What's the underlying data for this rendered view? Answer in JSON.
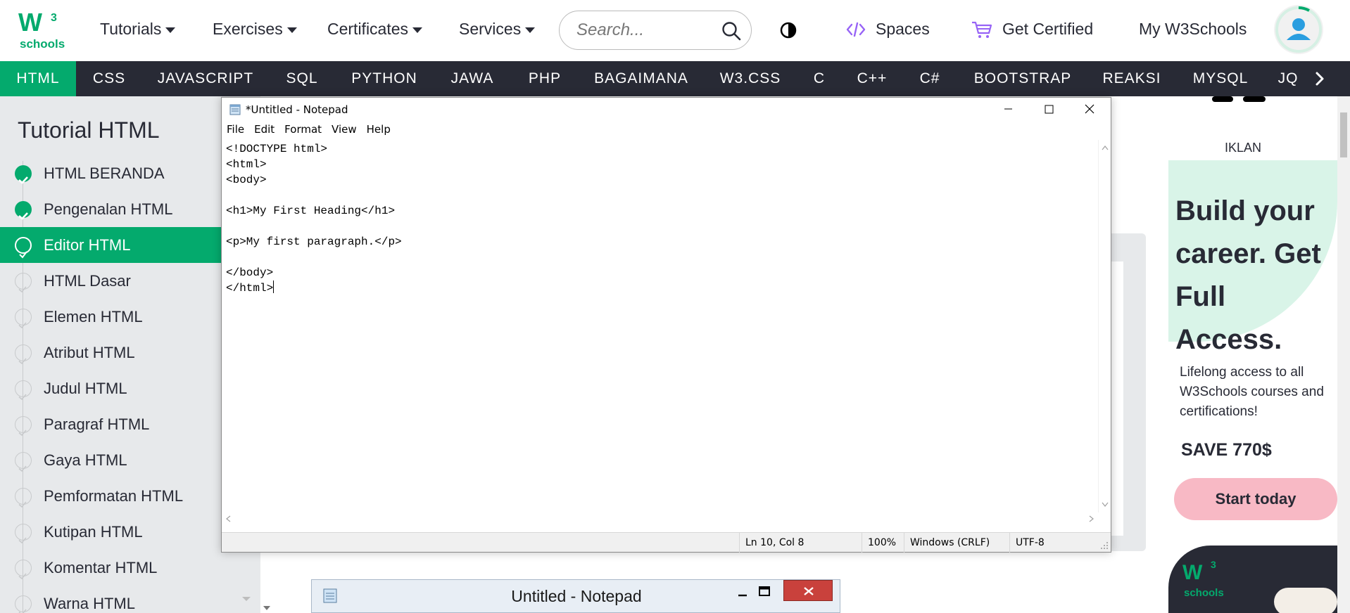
{
  "header": {
    "logo_mark": "W3",
    "logo_text": "schools",
    "menu": [
      {
        "label": "Tutorials"
      },
      {
        "label": "Exercises"
      },
      {
        "label": "Certificates"
      },
      {
        "label": "Services"
      }
    ],
    "search_placeholder": "Search...",
    "spaces_label": "Spaces",
    "get_certified_label": "Get Certified",
    "my_w3schools_label": "My W3Schools"
  },
  "subnav": {
    "items": [
      "HTML",
      "CSS",
      "JAVASCRIPT",
      "SQL",
      "PYTHON",
      "JAWA",
      "PHP",
      "BAGAIMANA",
      "W3.CSS",
      "C",
      "C++",
      "C#",
      "BOOTSTRAP",
      "REAKSI",
      "MYSQL",
      "JQ"
    ],
    "active": "HTML"
  },
  "sidebar": {
    "title": "Tutorial HTML",
    "items": [
      {
        "label": "HTML BERANDA",
        "state": "done"
      },
      {
        "label": "Pengenalan HTML",
        "state": "done"
      },
      {
        "label": "Editor HTML",
        "state": "current"
      },
      {
        "label": "HTML Dasar",
        "state": "todo"
      },
      {
        "label": "Elemen HTML",
        "state": "todo"
      },
      {
        "label": "Atribut HTML",
        "state": "todo"
      },
      {
        "label": "Judul HTML",
        "state": "todo"
      },
      {
        "label": "Paragraf HTML",
        "state": "todo"
      },
      {
        "label": "Gaya HTML",
        "state": "todo"
      },
      {
        "label": "Pemformatan HTML",
        "state": "todo"
      },
      {
        "label": "Kutipan HTML",
        "state": "todo"
      },
      {
        "label": "Komentar HTML",
        "state": "todo"
      },
      {
        "label": "Warna HTML",
        "state": "todo"
      }
    ]
  },
  "ad": {
    "label": "IKLAN",
    "headline": "Build your career. Get Full Access.",
    "subtext": "Lifelong access to all W3Schools courses and certifications!",
    "save": "SAVE 770$",
    "cta": "Start today",
    "brand_text": "schools"
  },
  "notepad": {
    "title": "*Untitled - Notepad",
    "menu": [
      "File",
      "Edit",
      "Format",
      "View",
      "Help"
    ],
    "content": "<!DOCTYPE html>\n<html>\n<body>\n\n<h1>My First Heading</h1>\n\n<p>My first paragraph.</p>\n\n</body>\n</html>",
    "status": {
      "position": "Ln 10, Col 8",
      "zoom": "100%",
      "line_ending": "Windows (CRLF)",
      "encoding": "UTF-8"
    }
  },
  "old_notepad": {
    "title": "Untitled - Notepad"
  },
  "colors": {
    "brand_green": "#04aa6d",
    "dark_nav": "#282a35",
    "sidebar_bg": "#e7e9eb",
    "spaces_purple": "#9763f6",
    "ad_pink": "#f8b9c5"
  }
}
